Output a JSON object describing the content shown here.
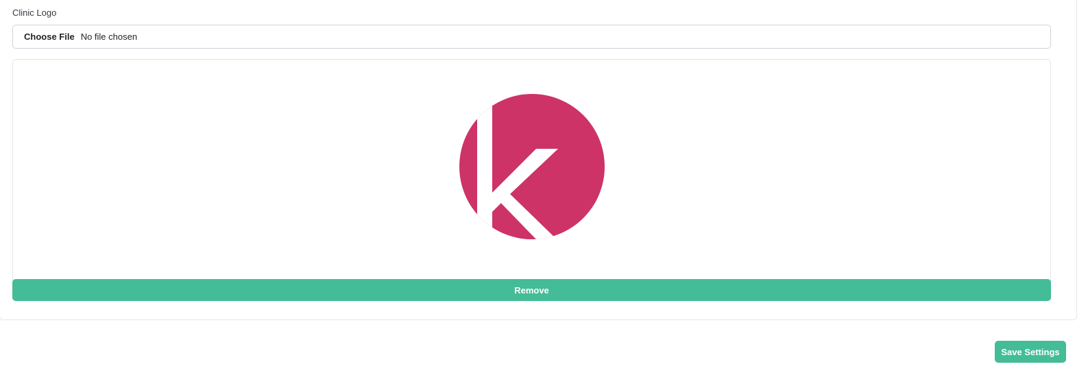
{
  "logo_section": {
    "label": "Clinic Logo",
    "file_input": {
      "button_label": "Choose File",
      "status": "No file chosen"
    },
    "preview": {
      "logo_icon": "k-circle-logo",
      "logo_color": "#cd3366"
    },
    "remove_label": "Remove"
  },
  "actions": {
    "save_label": "Save Settings"
  },
  "colors": {
    "accent": "#43bc97",
    "border": "#ced4da"
  }
}
